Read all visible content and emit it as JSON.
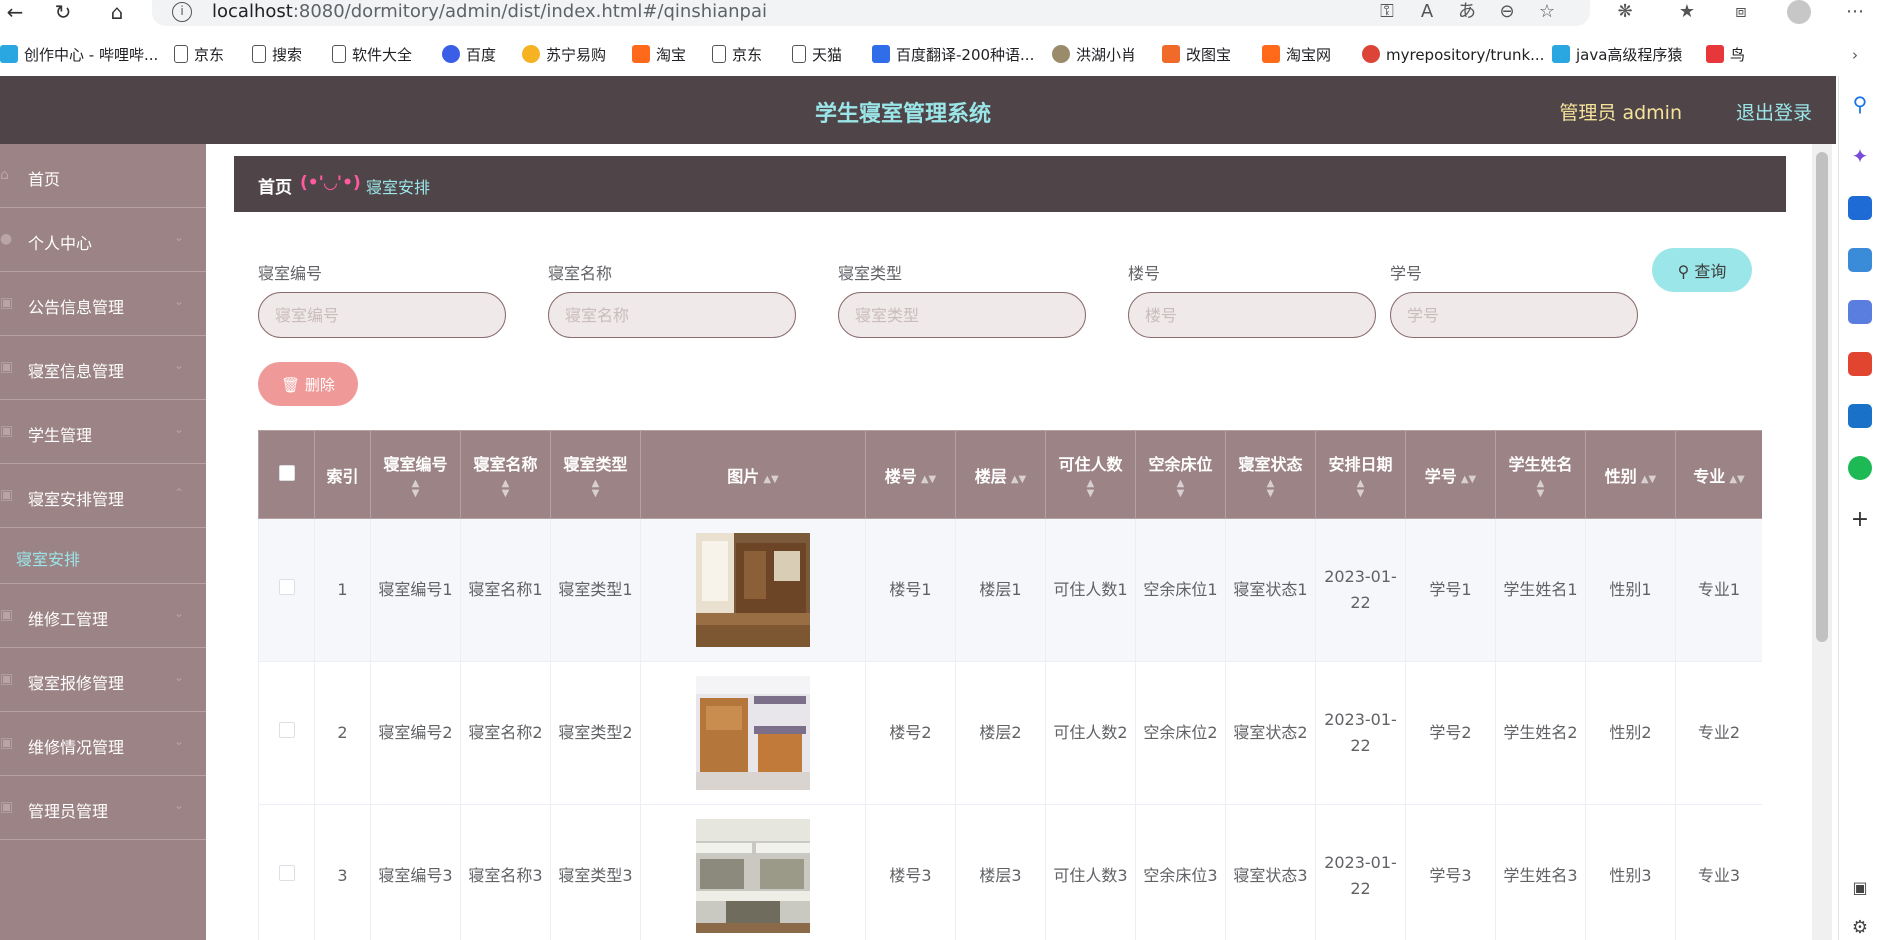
{
  "browser": {
    "url_host": "localhost",
    "url_rest": ":8080/dormitory/admin/dist/index.html#/qinshianpai",
    "bookmarks": [
      "创作中心 - 哔哩哔...",
      "京东",
      "搜索",
      "软件大全",
      "百度",
      "苏宁易购",
      "淘宝",
      "京东",
      "天猫",
      "百度翻译-200种语...",
      "洪湖小肖",
      "改图宝",
      "淘宝网",
      "myrepository/trunk...",
      "java高级程序猿",
      "鸟"
    ]
  },
  "header": {
    "title": "学生寝室管理系统",
    "admin": "管理员 admin",
    "logout": "退出登录"
  },
  "sidebar": {
    "items": [
      {
        "label": "首页"
      },
      {
        "label": "个人中心"
      },
      {
        "label": "公告信息管理"
      },
      {
        "label": "寝室信息管理"
      },
      {
        "label": "学生管理"
      },
      {
        "label": "寝室安排管理"
      },
      {
        "label": "寝室安排"
      },
      {
        "label": "维修工管理"
      },
      {
        "label": "寝室报修管理"
      },
      {
        "label": "维修情况管理"
      },
      {
        "label": "管理员管理"
      }
    ]
  },
  "breadcrumb": {
    "home": "首页",
    "emoji": "(•'◡'•)",
    "current": "寝室安排"
  },
  "search": {
    "fields": [
      {
        "label": "寝室编号",
        "placeholder": "寝室编号"
      },
      {
        "label": "寝室名称",
        "placeholder": "寝室名称"
      },
      {
        "label": "寝室类型",
        "placeholder": "寝室类型"
      },
      {
        "label": "楼号",
        "placeholder": "楼号"
      },
      {
        "label": "学号",
        "placeholder": "学号"
      }
    ],
    "query_label": "查询",
    "delete_label": "删除"
  },
  "table": {
    "columns": [
      "索引",
      "寝室编号",
      "寝室名称",
      "寝室类型",
      "图片",
      "楼号",
      "楼层",
      "可住人数",
      "空余床位",
      "寝室状态",
      "安排日期",
      "学号",
      "学生姓名",
      "性别",
      "专业"
    ],
    "rows": [
      {
        "index": "1",
        "room_no": "寝室编号1",
        "room_name": "寝室名称1",
        "room_type": "寝室类型1",
        "building": "楼号1",
        "floor": "楼层1",
        "capacity": "可住人数1",
        "free_beds": "空余床位1",
        "status": "寝室状态1",
        "date": "2023-01-22",
        "student_no": "学号1",
        "student_name": "学生姓名1",
        "gender": "性别1",
        "major": "专业1"
      },
      {
        "index": "2",
        "room_no": "寝室编号2",
        "room_name": "寝室名称2",
        "room_type": "寝室类型2",
        "building": "楼号2",
        "floor": "楼层2",
        "capacity": "可住人数2",
        "free_beds": "空余床位2",
        "status": "寝室状态2",
        "date": "2023-01-22",
        "student_no": "学号2",
        "student_name": "学生姓名2",
        "gender": "性别2",
        "major": "专业2"
      },
      {
        "index": "3",
        "room_no": "寝室编号3",
        "room_name": "寝室名称3",
        "room_type": "寝室类型3",
        "building": "楼号3",
        "floor": "楼层3",
        "capacity": "可住人数3",
        "free_beds": "空余床位3",
        "status": "寝室状态3",
        "date": "2023-01-22",
        "student_no": "学号3",
        "student_name": "学生姓名3",
        "gender": "性别3",
        "major": "专业3"
      }
    ]
  },
  "colors": {
    "topbar": "#4f4548",
    "sidebar": "#9c8386",
    "accent_cyan": "#9ae6e8",
    "accent_yellow": "#f6e39b",
    "delete_red": "#ef9a99"
  }
}
